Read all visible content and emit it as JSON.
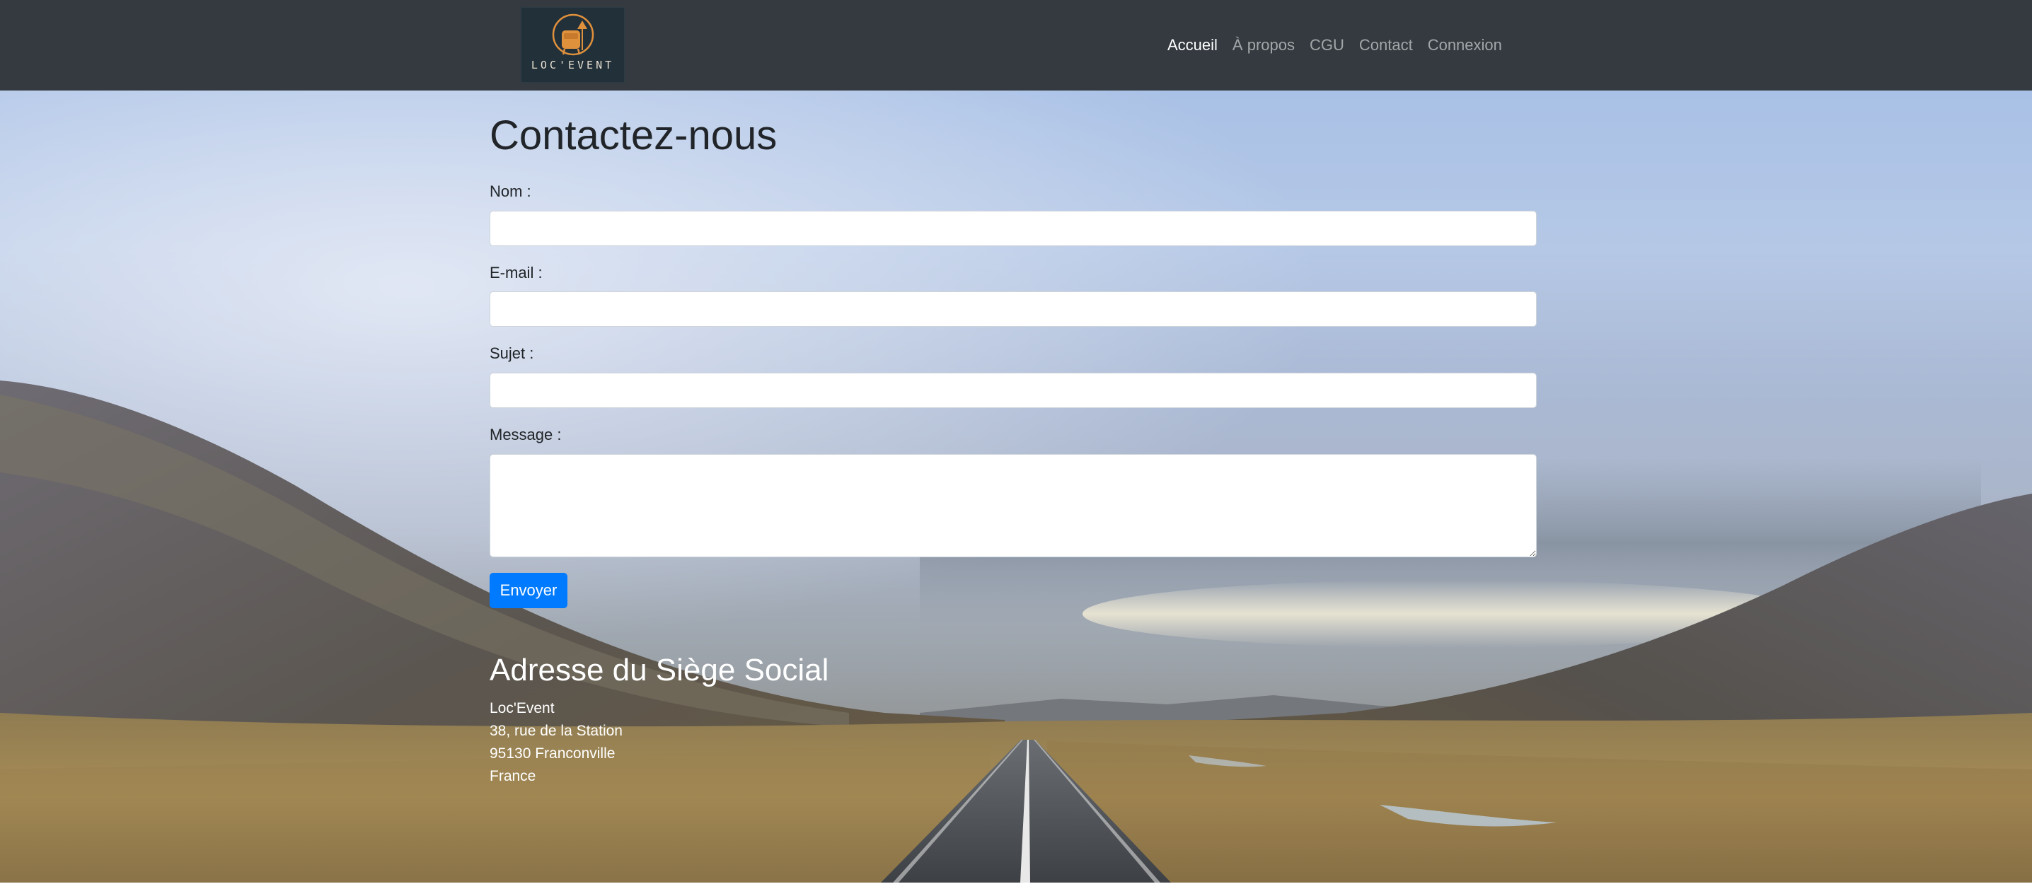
{
  "brand": {
    "logo_text": "LOC'EVENT"
  },
  "nav": {
    "items": [
      {
        "label": "Accueil",
        "active": true
      },
      {
        "label": "À propos",
        "active": false
      },
      {
        "label": "CGU",
        "active": false
      },
      {
        "label": "Contact",
        "active": false
      },
      {
        "label": "Connexion",
        "active": false
      }
    ]
  },
  "contact_form": {
    "title": "Contactez-nous",
    "name_label": "Nom :",
    "name_value": "",
    "email_label": "E-mail :",
    "email_value": "",
    "subject_label": "Sujet :",
    "subject_value": "",
    "message_label": "Message :",
    "message_value": "",
    "submit_label": "Envoyer"
  },
  "address": {
    "title": "Adresse du Siège Social",
    "company": "Loc'Event",
    "street": "38, rue de la Station",
    "city": "95130 Franconville",
    "country": "France"
  },
  "colors": {
    "navbar_bg": "#343a40",
    "primary_button": "#007bff",
    "logo_accent": "#e0913c"
  }
}
